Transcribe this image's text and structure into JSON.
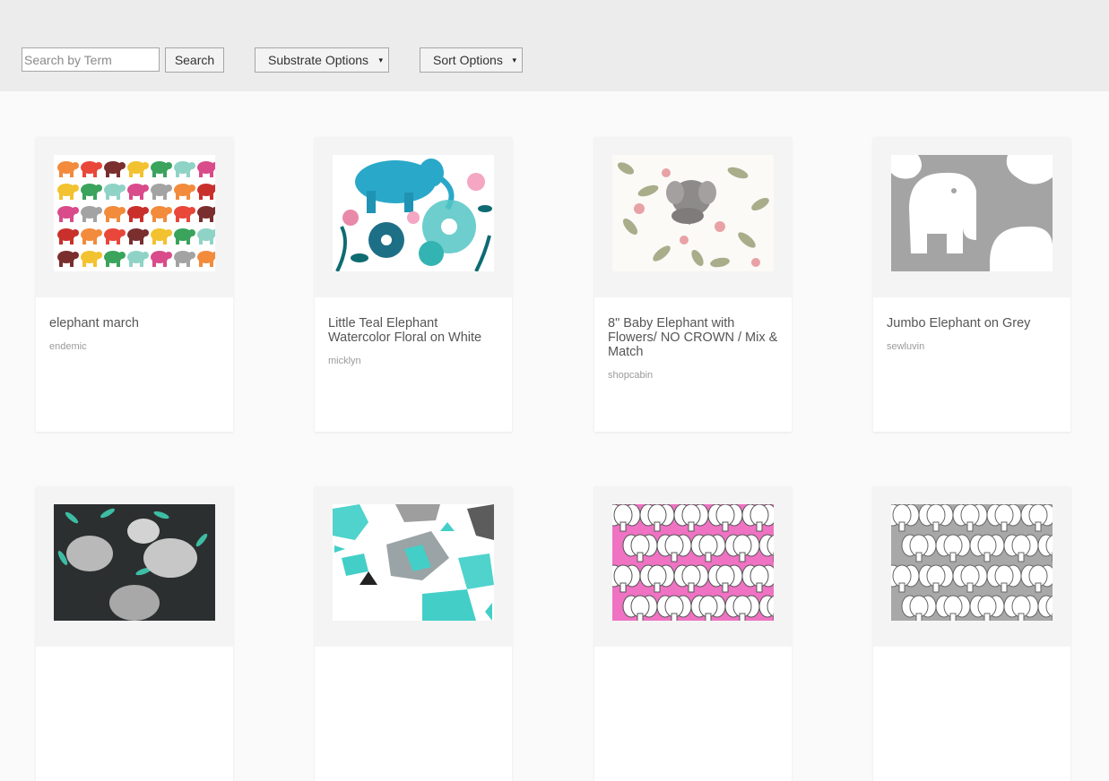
{
  "toolbar": {
    "search_placeholder": "Search by Term",
    "search_button": "Search",
    "substrate_label": "Substrate Options",
    "sort_label": "Sort Options",
    "caret": "▾"
  },
  "products": [
    {
      "title": "elephant march",
      "author": "endemic",
      "pattern": "colorful-elephant-rows"
    },
    {
      "title": "Little Teal Elephant Watercolor Floral on White",
      "author": "micklyn",
      "pattern": "teal-elephant-floral"
    },
    {
      "title": "8\" Baby Elephant with Flowers/ NO CROWN / Mix & Match",
      "author": "shopcabin",
      "pattern": "baby-elephant-flowers"
    },
    {
      "title": "Jumbo Elephant on Grey",
      "author": "sewluvin",
      "pattern": "jumbo-elephant-grey"
    },
    {
      "title": "",
      "author": "",
      "pattern": "grey-elephants-dark-leaves"
    },
    {
      "title": "",
      "author": "",
      "pattern": "geometric-teal-elephants"
    },
    {
      "title": "",
      "author": "",
      "pattern": "white-elephants-on-pink"
    },
    {
      "title": "",
      "author": "",
      "pattern": "white-elephants-on-grey"
    }
  ]
}
